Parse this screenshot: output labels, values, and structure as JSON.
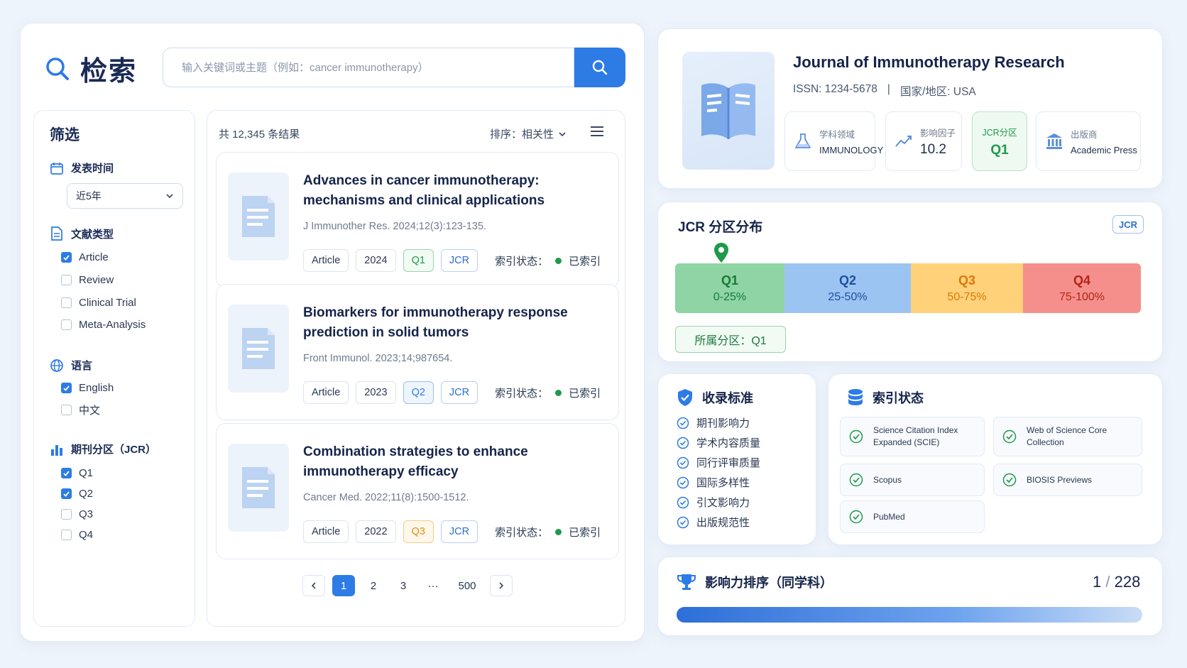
{
  "search": {
    "title": "检索",
    "placeholder": "输入关键词或主题（例如：cancer immunotherapy）"
  },
  "filters": {
    "title": "筛选",
    "date": {
      "label": "发表时间",
      "selected": "近5年"
    },
    "doc_type": {
      "label": "文献类型",
      "options": [
        {
          "label": "Article",
          "checked": true
        },
        {
          "label": "Review",
          "checked": false
        },
        {
          "label": "Clinical Trial",
          "checked": false
        },
        {
          "label": "Meta-Analysis",
          "checked": false
        }
      ]
    },
    "language": {
      "label": "语言",
      "options": [
        {
          "label": "English",
          "checked": true
        },
        {
          "label": "中文",
          "checked": false
        }
      ]
    },
    "jcr": {
      "label": "期刊分区（JCR）",
      "options": [
        {
          "label": "Q1",
          "checked": true
        },
        {
          "label": "Q2",
          "checked": true
        },
        {
          "label": "Q3",
          "checked": false
        },
        {
          "label": "Q4",
          "checked": false
        }
      ]
    }
  },
  "results": {
    "count_text": "共 12,345 条结果",
    "sort_label": "排序：相关性",
    "status_label": "索引状态：",
    "items": [
      {
        "title": "Advances in cancer immunotherapy: mechanisms and clinical applications",
        "citation": "J Immunother Res. 2024;12(3):123-135.",
        "type": "Article",
        "year": "2024",
        "quartile": "Q1",
        "jcr": "JCR",
        "status": "已索引"
      },
      {
        "title": "Biomarkers for immunotherapy response prediction in solid tumors",
        "citation": "Front Immunol. 2023;14;987654.",
        "type": "Article",
        "year": "2023",
        "quartile": "Q2",
        "jcr": "JCR",
        "status": "已索引"
      },
      {
        "title": "Combination strategies to enhance immunotherapy efficacy",
        "citation": "Cancer Med. 2022;11(8):1500-1512.",
        "type": "Article",
        "year": "2022",
        "quartile": "Q3",
        "jcr": "JCR",
        "status": "已索引"
      }
    ],
    "pagination": {
      "pages": [
        "1",
        "2",
        "3",
        "···",
        "500"
      ],
      "current": "1"
    }
  },
  "journal": {
    "title": "Journal of Immunotherapy Research",
    "issn": "ISSN: 1234-5678",
    "divider": "|",
    "region": "国家/地区: USA",
    "metrics": {
      "field_label": "学科领域",
      "field_value": "IMMUNOLOGY",
      "if_label": "影响因子",
      "if_value": "10.2",
      "jcr_label": "JCR分区",
      "jcr_value": "Q1",
      "publisher_label": "出版商",
      "publisher_value": "Academic Press"
    }
  },
  "jcr_distribution": {
    "title": "JCR 分区分布",
    "badge": "JCR",
    "quartiles": [
      {
        "name": "Q1",
        "range": "0-25%",
        "bg": "#8fd4a4",
        "fg": "#167a3a"
      },
      {
        "name": "Q2",
        "range": "25-50%",
        "bg": "#9cc4f2",
        "fg": "#1d4f9c"
      },
      {
        "name": "Q3",
        "range": "50-75%",
        "bg": "#ffd27a",
        "fg": "#d9780c"
      },
      {
        "name": "Q4",
        "range": "75-100%",
        "bg": "#f58f8b",
        "fg": "#b42318"
      }
    ],
    "own_label": "所属分区：Q1"
  },
  "criteria": {
    "title": "收录标准",
    "items": [
      "期刊影响力",
      "学术内容质量",
      "同行评审质量",
      "国际多样性",
      "引文影响力",
      "出版规范性"
    ]
  },
  "index_status": {
    "title": "索引状态",
    "databases": [
      "Science Citation Index Expanded (SCIE)",
      "Web of Science Core Collection",
      "Scopus",
      "BIOSIS Previews",
      "PubMed"
    ]
  },
  "ranking": {
    "title": "影响力排序（同学科）",
    "rank": "1",
    "separator": "/",
    "total": "228"
  },
  "colors": {
    "accent": "#2d7be5",
    "success": "#1e9a4a",
    "warning": "#e58a10"
  }
}
